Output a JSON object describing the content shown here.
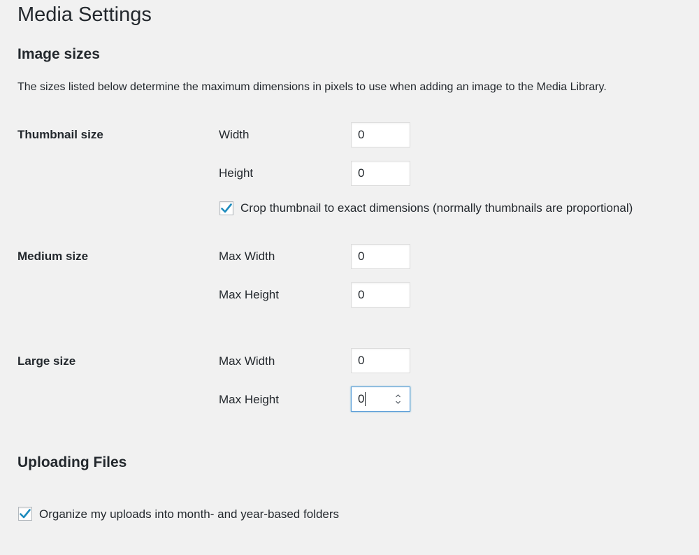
{
  "page": {
    "title": "Media Settings"
  },
  "image_sizes": {
    "heading": "Image sizes",
    "description": "The sizes listed below determine the maximum dimensions in pixels to use when adding an image to the Media Library.",
    "thumbnail": {
      "label": "Thumbnail size",
      "width_label": "Width",
      "width_value": "0",
      "height_label": "Height",
      "height_value": "0",
      "crop_checked": true,
      "crop_label": "Crop thumbnail to exact dimensions (normally thumbnails are proportional)"
    },
    "medium": {
      "label": "Medium size",
      "width_label": "Max Width",
      "width_value": "0",
      "height_label": "Max Height",
      "height_value": "0"
    },
    "large": {
      "label": "Large size",
      "width_label": "Max Width",
      "width_value": "0",
      "height_label": "Max Height",
      "height_value": "0"
    }
  },
  "uploading": {
    "heading": "Uploading Files",
    "organize_checked": true,
    "organize_label": "Organize my uploads into month- and year-based folders"
  },
  "colors": {
    "background": "#f1f1f1",
    "text": "#23282d",
    "check": "#1e8cbe",
    "focus_border": "#5b9dd9"
  }
}
